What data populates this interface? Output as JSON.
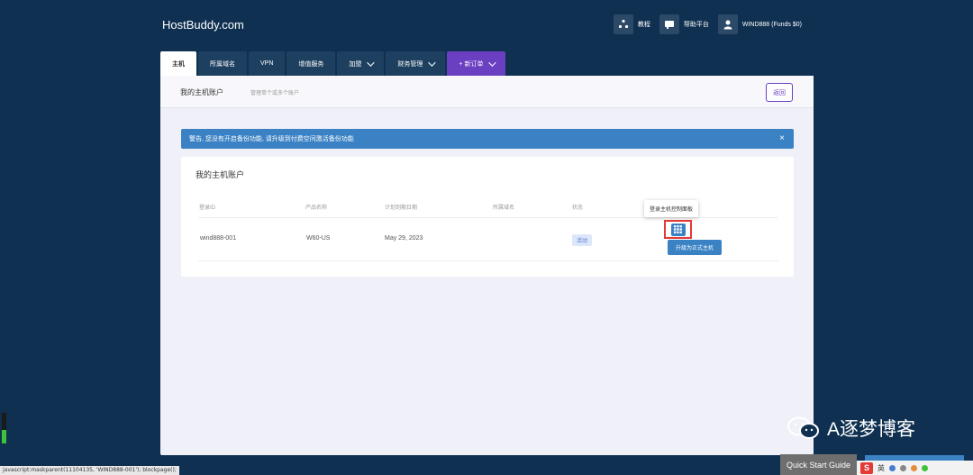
{
  "brand": "HostBuddy.com",
  "topnav": {
    "tutorial": "教程",
    "help": "帮助平台",
    "account": "WIND888 (Funds $0)"
  },
  "tabs": [
    {
      "label": "主机"
    },
    {
      "label": "所属域名"
    },
    {
      "label": "VPN"
    },
    {
      "label": "增值服务"
    },
    {
      "label": "加盟"
    },
    {
      "label": "财务管理"
    },
    {
      "label": "+ 新订单"
    }
  ],
  "panel": {
    "title": "我的主机账户",
    "subtitle": "管理单个或多个账户",
    "back": "返回"
  },
  "alert": {
    "text": "警告, 您没有开启备份功能, 请升级到付费空间激活备份功能",
    "close": "×"
  },
  "card": {
    "title": "我的主机账户",
    "columns": [
      "登录ID",
      "产品名称",
      "计划到期日期",
      "所属域名",
      "状态"
    ],
    "row": {
      "login_id": "wind888-001",
      "product": "W60-US",
      "expiry": "May 29, 2023",
      "domain": "",
      "status": "活动"
    },
    "tooltip": "登录主机控制面板",
    "upgrade": "升级为正式主机"
  },
  "statusbar": "javascript:maskparent(11104135, 'WIND888-001'); blockpage();",
  "meter_fraction": 0.45,
  "watermark": "A逐梦博客",
  "quick_start": "Quick Start Guide",
  "tray": {
    "ime_logo": "S",
    "lang": "英"
  },
  "colors": {
    "background": "#0f3050",
    "accent_blue": "#3a82c4",
    "accent_purple": "#6b3fc2",
    "highlight_red": "#e53935"
  }
}
